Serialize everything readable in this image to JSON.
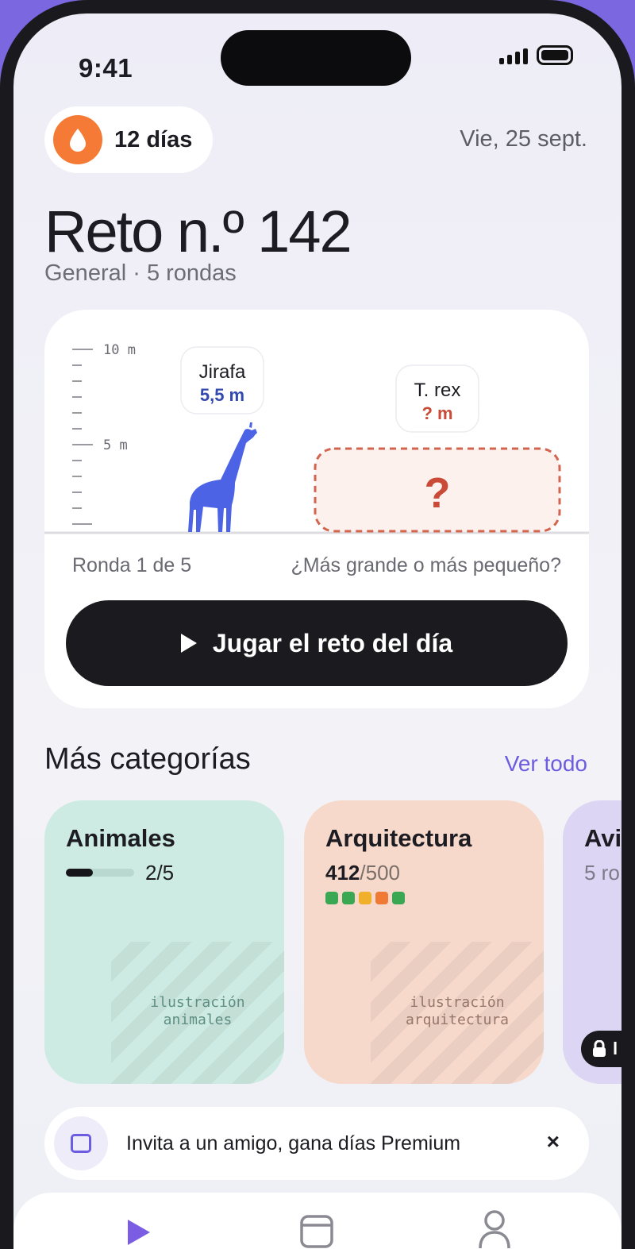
{
  "status": {
    "time": "9:41"
  },
  "streak": {
    "label": "12 días"
  },
  "header": {
    "date": "Vie, 25 sept."
  },
  "challenge": {
    "title": "Reto n.º 142",
    "subtitle": "General · 5 rondas",
    "ruler": {
      "top_label": "10 m",
      "mid_label": "5 m"
    },
    "known": {
      "name": "Jirafa",
      "value": "5,5 m",
      "height_m": 5.5
    },
    "unknown": {
      "name": "T. rex",
      "value": "? m",
      "mark": "?"
    },
    "round_label": "Ronda 1 de 5",
    "question": "¿Más grande o más pequeño?",
    "play_label": "Jugar el reto del día"
  },
  "categories_section": {
    "title": "Más categorías",
    "see_all": "Ver todo",
    "items": [
      {
        "name": "Animales",
        "progress_text": "2/5",
        "progress_fraction": 0.4,
        "illustration": "ilustración\nanimales",
        "bg": "#cdebe2"
      },
      {
        "name": "Arquitectura",
        "score": "412",
        "score_total": "/500",
        "illustration": "ilustración\narquitectura",
        "bg": "#f6d9cb",
        "dots": [
          "#3aa853",
          "#3aa853",
          "#f0b02a",
          "#f07a35",
          "#3aa853"
        ]
      },
      {
        "name": "Avi",
        "sub": "5 ro",
        "bg": "#dcd5f3",
        "lock_label": "l"
      }
    ]
  },
  "invite": {
    "text": "Invita a un amigo, gana días Premium",
    "close": "×"
  },
  "colors": {
    "accent": "#6c5ce0",
    "giraffe": "#4d63e6",
    "danger": "#c94a36",
    "streak": "#f57a35"
  },
  "icons": {
    "streak": "drop-icon",
    "play": "play-icon",
    "calendar": "calendar-icon",
    "profile": "user-icon",
    "lock": "lock-icon",
    "gift": "square-icon"
  }
}
